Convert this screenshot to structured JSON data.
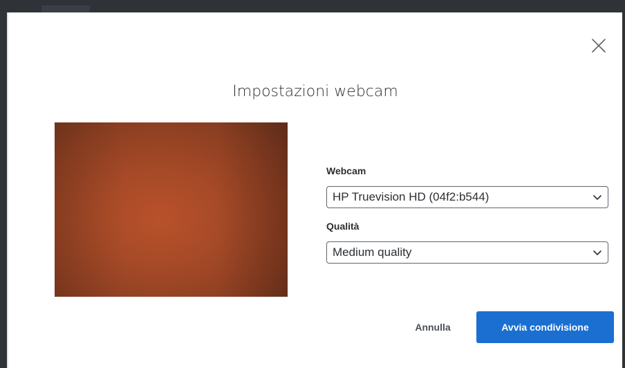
{
  "dialog": {
    "title": "Impostazioni webcam",
    "close_icon": "close-icon"
  },
  "preview": {
    "icon": "webcam-preview"
  },
  "fields": {
    "webcam_label": "Webcam",
    "webcam_value": "HP Truevision HD (04f2:b544)",
    "quality_label": "Qualità",
    "quality_value": "Medium quality"
  },
  "actions": {
    "cancel_label": "Annulla",
    "start_label": "Avvia condivisione"
  },
  "colors": {
    "primary": "#1a6fd1",
    "backdrop": "#2f3337"
  }
}
